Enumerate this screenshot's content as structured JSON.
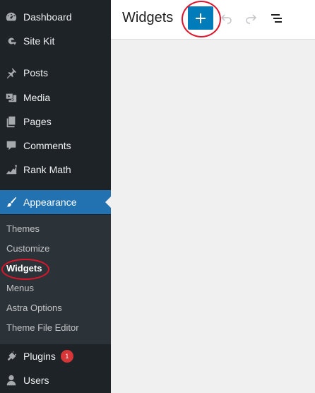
{
  "sidebar": {
    "items": [
      {
        "label": "Dashboard",
        "icon": "dashboard-icon"
      },
      {
        "label": "Site Kit",
        "icon": "site-kit-icon"
      },
      {
        "label": "Posts",
        "icon": "pushpin-icon"
      },
      {
        "label": "Media",
        "icon": "media-icon"
      },
      {
        "label": "Pages",
        "icon": "pages-icon"
      },
      {
        "label": "Comments",
        "icon": "comment-icon"
      },
      {
        "label": "Rank Math",
        "icon": "rank-math-icon"
      },
      {
        "label": "Appearance",
        "icon": "paintbrush-icon"
      },
      {
        "label": "Plugins",
        "icon": "plugin-icon",
        "badge": "1"
      },
      {
        "label": "Users",
        "icon": "users-icon"
      }
    ],
    "submenu": [
      "Themes",
      "Customize",
      "Widgets",
      "Menus",
      "Astra Options",
      "Theme File Editor"
    ]
  },
  "header": {
    "title": "Widgets"
  },
  "colors": {
    "sidebar_bg": "#1d2327",
    "submenu_bg": "#2c3338",
    "accent": "#2271b1",
    "add_button": "#007cba",
    "badge": "#d63638",
    "annotation": "#e0142b"
  }
}
